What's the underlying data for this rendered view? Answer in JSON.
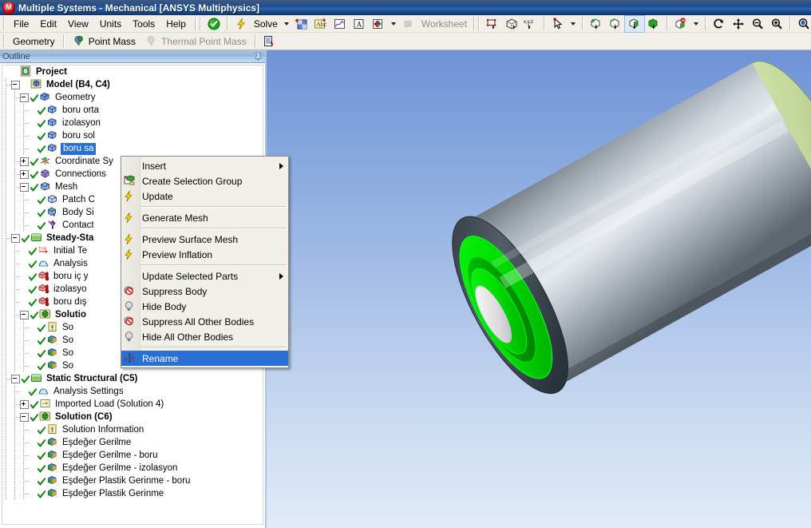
{
  "window": {
    "title": "Multiple Systems - Mechanical [ANSYS Multiphysics]",
    "app_icon": "ansys-mechanical-icon",
    "app_icon_glyph": "M"
  },
  "menubar": {
    "items": [
      {
        "label": "File",
        "name": "menu-file"
      },
      {
        "label": "Edit",
        "name": "menu-edit"
      },
      {
        "label": "View",
        "name": "menu-view"
      },
      {
        "label": "Units",
        "name": "menu-units"
      },
      {
        "label": "Tools",
        "name": "menu-tools"
      },
      {
        "label": "Help",
        "name": "menu-help"
      }
    ]
  },
  "toolbar": {
    "solve_label": "Solve",
    "worksheet_label": "Worksheet",
    "icons": [
      {
        "name": "check-green-icon",
        "title": "Validate"
      },
      {
        "name": "solve-lightning-icon",
        "title": "Solve"
      },
      {
        "name": "solve-dropdown-caret-icon",
        "title": "Solve options"
      },
      {
        "name": "new-chart-icon",
        "title": "New Chart and Table"
      },
      {
        "name": "new-comment-icon",
        "title": "New Comment"
      },
      {
        "name": "new-figure-icon",
        "title": "New Figure"
      },
      {
        "name": "new-annotation-icon",
        "title": "New Annotation"
      },
      {
        "name": "new-section-plane-icon",
        "title": "New Section Plane"
      },
      {
        "name": "section-dropdown-caret-icon",
        "title": "Section options"
      },
      {
        "name": "worksheet-icon",
        "title": "Worksheet"
      },
      {
        "name": "show-vertices-icon",
        "title": "Show Vertices"
      },
      {
        "name": "wireframe-icon",
        "title": "Wireframe"
      },
      {
        "name": "show-mesh-xyz-icon",
        "title": "Show Mesh"
      },
      {
        "name": "select-mode-cursor-icon",
        "title": "Select Mode"
      },
      {
        "name": "select-mode-caret-icon",
        "title": "Select Mode options"
      },
      {
        "name": "select-vertex-icon",
        "title": "Vertex Select"
      },
      {
        "name": "select-edge-icon",
        "title": "Edge Select"
      },
      {
        "name": "select-face-icon",
        "title": "Face Select"
      },
      {
        "name": "select-body-icon",
        "title": "Body Select"
      },
      {
        "name": "extend-selection-icon",
        "title": "Extend Selection"
      },
      {
        "name": "extend-dropdown-caret-icon",
        "title": "Extend options"
      },
      {
        "name": "rotate-icon",
        "title": "Rotate"
      },
      {
        "name": "pan-icon",
        "title": "Pan"
      },
      {
        "name": "zoom-icon",
        "title": "Zoom"
      },
      {
        "name": "box-zoom-icon",
        "title": "Box Zoom"
      },
      {
        "name": "zoom-to-fit-icon",
        "title": "Zoom To Fit"
      }
    ]
  },
  "context_toolbar": {
    "items": [
      {
        "label": "Geometry",
        "name": "ctx-geometry",
        "icon": "",
        "disabled": false
      },
      {
        "label": "Point Mass",
        "name": "ctx-point-mass",
        "icon": "point-mass-icon",
        "disabled": false
      },
      {
        "label": "Thermal Point Mass",
        "name": "ctx-thermal-point-mass",
        "icon": "thermal-point-mass-icon",
        "disabled": true
      }
    ],
    "trailing_icon": {
      "name": "worksheet-report-icon"
    }
  },
  "outline": {
    "header_title": "Outline",
    "pin_icon": "auto-hide-pin-icon",
    "tree": [
      {
        "label": "Project",
        "depth": 0,
        "icon": "project-icon",
        "expander": "none",
        "check": false,
        "bold": true,
        "selected": false
      },
      {
        "label": "Model (B4, C4)",
        "depth": 1,
        "icon": "model-icon",
        "expander": "minus",
        "check": false,
        "bold": true,
        "selected": false
      },
      {
        "label": "Geometry",
        "depth": 2,
        "icon": "geometry-icon",
        "expander": "minus",
        "check": true,
        "bold": false,
        "selected": false
      },
      {
        "label": "boru orta",
        "depth": 3,
        "icon": "body-icon",
        "expander": "none",
        "check": true,
        "bold": false,
        "selected": false
      },
      {
        "label": "izolasyon",
        "depth": 3,
        "icon": "body-icon",
        "expander": "none",
        "check": true,
        "bold": false,
        "selected": false
      },
      {
        "label": "boru sol",
        "depth": 3,
        "icon": "body-icon",
        "expander": "none",
        "check": true,
        "bold": false,
        "selected": false
      },
      {
        "label": "boru sa",
        "depth": 3,
        "icon": "body-icon",
        "expander": "none",
        "check": true,
        "bold": false,
        "selected": true
      },
      {
        "label": "Coordinate Sy",
        "depth": 2,
        "icon": "coordinate-systems-icon",
        "expander": "plus",
        "check": true,
        "bold": false,
        "selected": false
      },
      {
        "label": "Connections",
        "depth": 2,
        "icon": "connections-icon",
        "expander": "plus",
        "check": true,
        "bold": false,
        "selected": false
      },
      {
        "label": "Mesh",
        "depth": 2,
        "icon": "mesh-icon",
        "expander": "minus",
        "check": true,
        "bold": false,
        "selected": false
      },
      {
        "label": "Patch C",
        "depth": 3,
        "icon": "patch-conforming-icon",
        "expander": "none",
        "check": true,
        "bold": false,
        "selected": false
      },
      {
        "label": "Body Si",
        "depth": 3,
        "icon": "body-sizing-icon",
        "expander": "none",
        "check": true,
        "bold": false,
        "selected": false
      },
      {
        "label": "Contact",
        "depth": 3,
        "icon": "contact-sizing-icon",
        "expander": "none",
        "check": true,
        "bold": false,
        "selected": false
      },
      {
        "label": "Steady-Sta",
        "depth": 1,
        "icon": "analysis-branch-icon",
        "expander": "minus",
        "check": true,
        "bold": true,
        "selected": false
      },
      {
        "label": "Initial Te",
        "depth": 2,
        "icon": "initial-temperature-icon",
        "expander": "none",
        "check": true,
        "bold": false,
        "selected": false
      },
      {
        "label": "Analysis",
        "depth": 2,
        "icon": "analysis-settings-icon",
        "expander": "none",
        "check": true,
        "bold": false,
        "selected": false
      },
      {
        "label": "boru iç y",
        "depth": 2,
        "icon": "convection-icon",
        "expander": "none",
        "check": true,
        "bold": false,
        "selected": false
      },
      {
        "label": "izolasyo",
        "depth": 2,
        "icon": "convection-icon",
        "expander": "none",
        "check": true,
        "bold": false,
        "selected": false
      },
      {
        "label": "boru dış",
        "depth": 2,
        "icon": "convection-icon",
        "expander": "none",
        "check": true,
        "bold": false,
        "selected": false
      },
      {
        "label": "Solutio",
        "depth": 2,
        "icon": "solution-icon",
        "expander": "minus",
        "check": true,
        "bold": true,
        "selected": false
      },
      {
        "label": "So",
        "depth": 3,
        "icon": "solution-information-icon",
        "expander": "none",
        "check": true,
        "bold": false,
        "selected": false
      },
      {
        "label": "So",
        "depth": 3,
        "icon": "result-icon",
        "expander": "none",
        "check": true,
        "bold": false,
        "selected": false
      },
      {
        "label": "So",
        "depth": 3,
        "icon": "result-icon",
        "expander": "none",
        "check": true,
        "bold": false,
        "selected": false
      },
      {
        "label": "So",
        "depth": 3,
        "icon": "result-icon",
        "expander": "none",
        "check": true,
        "bold": false,
        "selected": false
      },
      {
        "label": "Static Structural (C5)",
        "depth": 1,
        "icon": "analysis-branch-icon",
        "expander": "minus",
        "check": true,
        "bold": true,
        "selected": false
      },
      {
        "label": "Analysis Settings",
        "depth": 2,
        "icon": "analysis-settings-icon",
        "expander": "none",
        "check": true,
        "bold": false,
        "selected": false
      },
      {
        "label": "Imported Load (Solution 4)",
        "depth": 2,
        "icon": "imported-load-icon",
        "expander": "plus",
        "check": true,
        "bold": false,
        "selected": false
      },
      {
        "label": "Solution (C6)",
        "depth": 2,
        "icon": "solution-icon",
        "expander": "minus",
        "check": true,
        "bold": true,
        "selected": false
      },
      {
        "label": "Solution Information",
        "depth": 3,
        "icon": "solution-information-icon",
        "expander": "none",
        "check": true,
        "bold": false,
        "selected": false
      },
      {
        "label": "Eşdeğer Gerilme",
        "depth": 3,
        "icon": "result-icon",
        "expander": "none",
        "check": true,
        "bold": false,
        "selected": false
      },
      {
        "label": "Eşdeğer Gerilme - boru",
        "depth": 3,
        "icon": "result-icon",
        "expander": "none",
        "check": true,
        "bold": false,
        "selected": false
      },
      {
        "label": "Eşdeğer Gerilme - izolasyon",
        "depth": 3,
        "icon": "result-icon",
        "expander": "none",
        "check": true,
        "bold": false,
        "selected": false
      },
      {
        "label": "Eşdeğer Plastik Gerinme - boru",
        "depth": 3,
        "icon": "result-icon",
        "expander": "none",
        "check": true,
        "bold": false,
        "selected": false
      },
      {
        "label": "Eşdeğer Plastik Gerinme",
        "depth": 3,
        "icon": "result-icon",
        "expander": "none",
        "check": true,
        "bold": false,
        "selected": false
      }
    ]
  },
  "context_menu": {
    "items": [
      {
        "label": "Insert",
        "icon": "",
        "submenu": true,
        "separator_after": false,
        "highlight": false
      },
      {
        "label": "Create Selection Group",
        "icon": "create-selection-group-icon",
        "submenu": false,
        "separator_after": false,
        "highlight": false
      },
      {
        "label": "Update",
        "icon": "lightning-icon",
        "submenu": false,
        "separator_after": true,
        "highlight": false
      },
      {
        "label": "Generate Mesh",
        "icon": "lightning-icon",
        "submenu": false,
        "separator_after": true,
        "highlight": false
      },
      {
        "label": "Preview Surface Mesh",
        "icon": "lightning-icon",
        "submenu": false,
        "separator_after": false,
        "highlight": false
      },
      {
        "label": "Preview Inflation",
        "icon": "lightning-icon",
        "submenu": false,
        "separator_after": true,
        "highlight": false
      },
      {
        "label": "Update Selected Parts",
        "icon": "",
        "submenu": true,
        "separator_after": false,
        "highlight": false
      },
      {
        "label": "Suppress Body",
        "icon": "suppress-body-icon",
        "submenu": false,
        "separator_after": false,
        "highlight": false
      },
      {
        "label": "Hide Body",
        "icon": "hide-body-bulb-icon",
        "submenu": false,
        "separator_after": false,
        "highlight": false
      },
      {
        "label": "Suppress All Other Bodies",
        "icon": "suppress-body-icon",
        "submenu": false,
        "separator_after": false,
        "highlight": false
      },
      {
        "label": "Hide All Other Bodies",
        "icon": "hide-body-bulb-icon",
        "submenu": false,
        "separator_after": true,
        "highlight": false
      },
      {
        "label": "Rename",
        "icon": "rename-icon",
        "submenu": false,
        "separator_after": false,
        "highlight": true
      }
    ]
  },
  "viewport": {
    "model_name": "pipe-with-insulation-3d-model",
    "colors": {
      "background_top": "#6e93d6",
      "background_bottom": "#e2ebf8",
      "pipe_body": "#b8c0c8",
      "insulation_dark": "#4a535c",
      "selection_green": "#00e000",
      "selection_green_dark": "#008a00",
      "inner_bore": "#e8e8ea"
    }
  }
}
